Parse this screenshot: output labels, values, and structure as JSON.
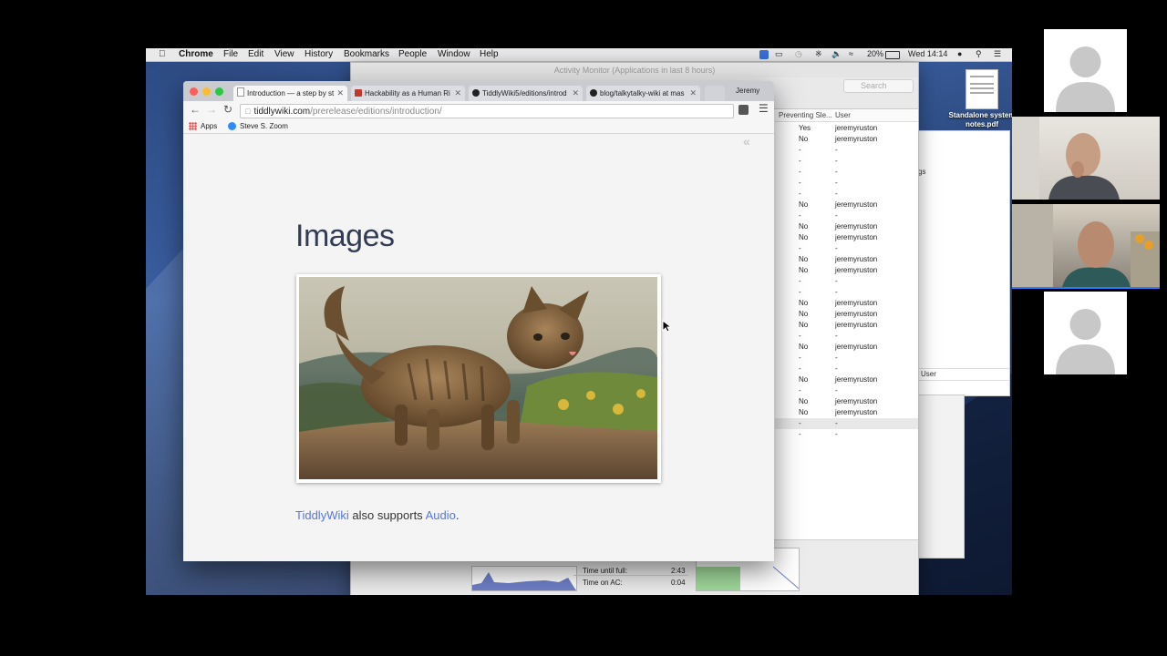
{
  "menubar": {
    "app": "Chrome",
    "items": [
      "File",
      "Edit",
      "View",
      "History",
      "Bookmarks",
      "People",
      "Window",
      "Help"
    ],
    "battery": "20%",
    "clock": "Wed 14:14"
  },
  "activity_monitor": {
    "title": "Activity Monitor (Applications in last 8 hours)",
    "search_placeholder": "Search",
    "col_preventing": "Preventing Sle...",
    "col_user": "User",
    "rows": [
      {
        "p": "Yes",
        "u": "jeremyruston"
      },
      {
        "p": "No",
        "u": "jeremyruston"
      },
      {
        "p": "-",
        "u": "-"
      },
      {
        "p": "-",
        "u": "-"
      },
      {
        "p": "-",
        "u": "-"
      },
      {
        "p": "-",
        "u": "-"
      },
      {
        "p": "-",
        "u": "-"
      },
      {
        "p": "No",
        "u": "jeremyruston"
      },
      {
        "p": "-",
        "u": "-"
      },
      {
        "p": "No",
        "u": "jeremyruston"
      },
      {
        "p": "No",
        "u": "jeremyruston"
      },
      {
        "p": "-",
        "u": "-"
      },
      {
        "p": "No",
        "u": "jeremyruston"
      },
      {
        "p": "No",
        "u": "jeremyruston"
      },
      {
        "p": "-",
        "u": "-"
      },
      {
        "p": "-",
        "u": "-"
      },
      {
        "p": "No",
        "u": "jeremyruston"
      },
      {
        "p": "No",
        "u": "jeremyruston"
      },
      {
        "p": "No",
        "u": "jeremyruston"
      },
      {
        "p": "-",
        "u": "-"
      },
      {
        "p": "No",
        "u": "jeremyruston"
      },
      {
        "p": "-",
        "u": "-"
      },
      {
        "p": "-",
        "u": "-"
      },
      {
        "p": "No",
        "u": "jeremyruston"
      },
      {
        "p": "-",
        "u": "-"
      },
      {
        "p": "No",
        "u": "jeremyruston"
      },
      {
        "p": "No",
        "u": "jeremyruston"
      },
      {
        "p": "-",
        "u": "-"
      },
      {
        "p": "-",
        "u": "-"
      }
    ],
    "time_until_full_label": "Time until full:",
    "time_until_full": "2:43",
    "time_on_ac_label": "Time on AC:",
    "time_on_ac": "0:04"
  },
  "side_window": {
    "partial_text": "gs",
    "user_label": "User"
  },
  "desktop_file": {
    "name": "Standalone system notes.pdf"
  },
  "chrome": {
    "profile": "Jeremy",
    "tabs": [
      {
        "label": "Introduction — a step by st",
        "active": true
      },
      {
        "label": "Hackability as a Human Ri",
        "active": false
      },
      {
        "label": "TiddlyWiki5/editions/introd",
        "active": false
      },
      {
        "label": "blog/talkytalky-wiki at mas",
        "active": false
      }
    ],
    "url_host": "tiddlywiki.com",
    "url_path": "/prerelease/editions/introduction/",
    "bookmarks": [
      {
        "label": "Apps"
      },
      {
        "label": "Steve S. Zoom"
      }
    ]
  },
  "page": {
    "heading": "Images",
    "caption_link1": "TiddlyWiki",
    "caption_mid": " also supports ",
    "caption_link2": "Audio",
    "caption_end": "."
  },
  "colors": {
    "link": "#5778d8",
    "heading": "#333c55",
    "desktop": "#2d4a82"
  }
}
